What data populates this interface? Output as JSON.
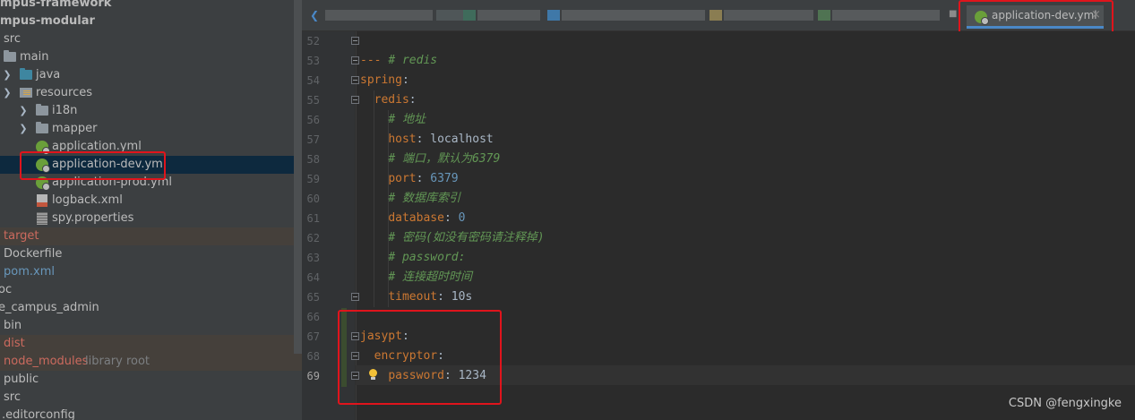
{
  "project_tree": {
    "rows": [
      {
        "label": "mpus-framework"
      },
      {
        "label": "mpus-modular"
      },
      {
        "label": "src"
      },
      {
        "label": "main"
      },
      {
        "label": "java"
      },
      {
        "label": "resources"
      },
      {
        "label": "i18n"
      },
      {
        "label": "mapper"
      },
      {
        "label": "application.yml"
      },
      {
        "label": "application-dev.yml"
      },
      {
        "label": "application-prod.yml"
      },
      {
        "label": "logback.xml"
      },
      {
        "label": "spy.properties"
      },
      {
        "label": "target"
      },
      {
        "label": "Dockerfile"
      },
      {
        "label": "pom.xml"
      },
      {
        "label": "oc"
      },
      {
        "label": "e_campus_admin"
      },
      {
        "label": "bin"
      },
      {
        "label": "dist"
      },
      {
        "label": "node_modules",
        "suffix": "library root"
      },
      {
        "label": "public"
      },
      {
        "label": "src"
      },
      {
        "label": ".editorconfig"
      }
    ]
  },
  "editor_tab": {
    "label": "application-dev.yml",
    "close_glyph": "×"
  },
  "editor": {
    "lines": [
      {
        "num": "52",
        "parts": []
      },
      {
        "num": "53",
        "parts": [
          {
            "t": "--- ",
            "c": "k"
          },
          {
            "t": "# redis",
            "c": "cm"
          }
        ]
      },
      {
        "num": "54",
        "parts": [
          {
            "t": "spring",
            "c": "k"
          },
          {
            "t": ":",
            "c": ""
          }
        ]
      },
      {
        "num": "55",
        "parts": [
          {
            "t": "  ",
            "c": ""
          },
          {
            "t": "redis",
            "c": "k"
          },
          {
            "t": ":",
            "c": ""
          }
        ]
      },
      {
        "num": "56",
        "parts": [
          {
            "t": "    ",
            "c": ""
          },
          {
            "t": "# 地址",
            "c": "cm"
          }
        ]
      },
      {
        "num": "57",
        "parts": [
          {
            "t": "    ",
            "c": ""
          },
          {
            "t": "host",
            "c": "k"
          },
          {
            "t": ": localhost",
            "c": ""
          }
        ]
      },
      {
        "num": "58",
        "parts": [
          {
            "t": "    ",
            "c": ""
          },
          {
            "t": "# 端口，默认为6379",
            "c": "cm"
          }
        ]
      },
      {
        "num": "59",
        "parts": [
          {
            "t": "    ",
            "c": ""
          },
          {
            "t": "port",
            "c": "k"
          },
          {
            "t": ": ",
            "c": ""
          },
          {
            "t": "6379",
            "c": "vn"
          }
        ]
      },
      {
        "num": "60",
        "parts": [
          {
            "t": "    ",
            "c": ""
          },
          {
            "t": "# 数据库索引",
            "c": "cm"
          }
        ]
      },
      {
        "num": "61",
        "parts": [
          {
            "t": "    ",
            "c": ""
          },
          {
            "t": "database",
            "c": "k"
          },
          {
            "t": ": ",
            "c": ""
          },
          {
            "t": "0",
            "c": "vn"
          }
        ]
      },
      {
        "num": "62",
        "parts": [
          {
            "t": "    ",
            "c": ""
          },
          {
            "t": "# 密码(如没有密码请注释掉)",
            "c": "cm"
          }
        ]
      },
      {
        "num": "63",
        "parts": [
          {
            "t": "    ",
            "c": ""
          },
          {
            "t": "# password:",
            "c": "cm"
          }
        ]
      },
      {
        "num": "64",
        "parts": [
          {
            "t": "    ",
            "c": ""
          },
          {
            "t": "# 连接超时时间",
            "c": "cm"
          }
        ]
      },
      {
        "num": "65",
        "parts": [
          {
            "t": "    ",
            "c": ""
          },
          {
            "t": "timeout",
            "c": "k"
          },
          {
            "t": ": 10s",
            "c": ""
          }
        ]
      },
      {
        "num": "66",
        "parts": []
      },
      {
        "num": "67",
        "parts": [
          {
            "t": "jasypt",
            "c": "k"
          },
          {
            "t": ":",
            "c": ""
          }
        ]
      },
      {
        "num": "68",
        "parts": [
          {
            "t": "  ",
            "c": ""
          },
          {
            "t": "encryptor",
            "c": "k"
          },
          {
            "t": ":",
            "c": ""
          }
        ]
      },
      {
        "num": "69",
        "parts": [
          {
            "t": "    ",
            "c": ""
          },
          {
            "t": "password",
            "c": "k"
          },
          {
            "t": ": 1234",
            "c": ""
          }
        ]
      }
    ]
  },
  "watermark": "CSDN @fengxingke",
  "colors": {
    "keyword": "#cc7832",
    "comment": "#629755",
    "number": "#6897bb",
    "text": "#a9b7c6",
    "highlight_box": "#e0141c",
    "selection": "#0d293e",
    "excluded": "#45403b"
  }
}
